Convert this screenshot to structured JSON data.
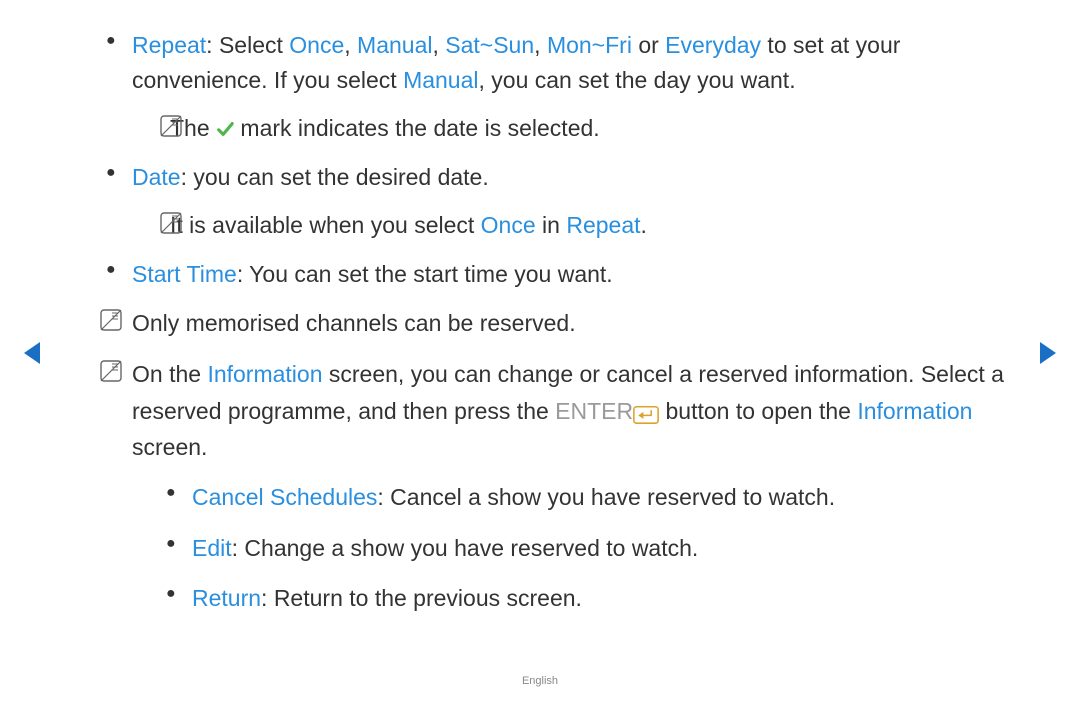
{
  "nav": {
    "prev_label": "previous-page",
    "next_label": "next-page"
  },
  "bullets": {
    "repeat": {
      "label": "Repeat",
      "t1": ": Select ",
      "opt_once": "Once",
      "sep1": ", ",
      "opt_manual": "Manual",
      "sep2": ", ",
      "opt_satsun": "Sat~Sun",
      "sep3": ", ",
      "opt_monfri": "Mon~Fri",
      "or": " or ",
      "opt_everyday": "Everyday",
      "t2": " to set at your convenience. If you select ",
      "opt_manual2": "Manual",
      "t3": ", you can set the day you want.",
      "note_the": "The ",
      "note_rest": " mark indicates the date is selected."
    },
    "date": {
      "label": "Date",
      "t1": ": you can set the desired date.",
      "note_pre": "It is available when you select ",
      "note_once": "Once",
      "note_in": " in ",
      "note_repeat": "Repeat",
      "note_dot": "."
    },
    "starttime": {
      "label": "Start Time",
      "t1": ": You can set the start time you want."
    }
  },
  "outer_notes": {
    "n1": "Only memorised channels can be reserved.",
    "n2_pre": "On the ",
    "n2_info1": "Information",
    "n2_mid1": " screen, you can change or cancel a reserved information. Select a reserved programme, and then press the ",
    "n2_enter": "ENTER",
    "n2_mid2": " button to open the ",
    "n2_info2": "Information",
    "n2_end": " screen."
  },
  "sub_bullets": {
    "cancel": {
      "label": "Cancel Schedules",
      "t": ": Cancel a show you have reserved to watch."
    },
    "edit": {
      "label": "Edit",
      "t": ": Change a show you have reserved to watch."
    },
    "return": {
      "label": "Return",
      "t": ": Return to the previous screen."
    }
  },
  "footer": {
    "lang": "English"
  }
}
